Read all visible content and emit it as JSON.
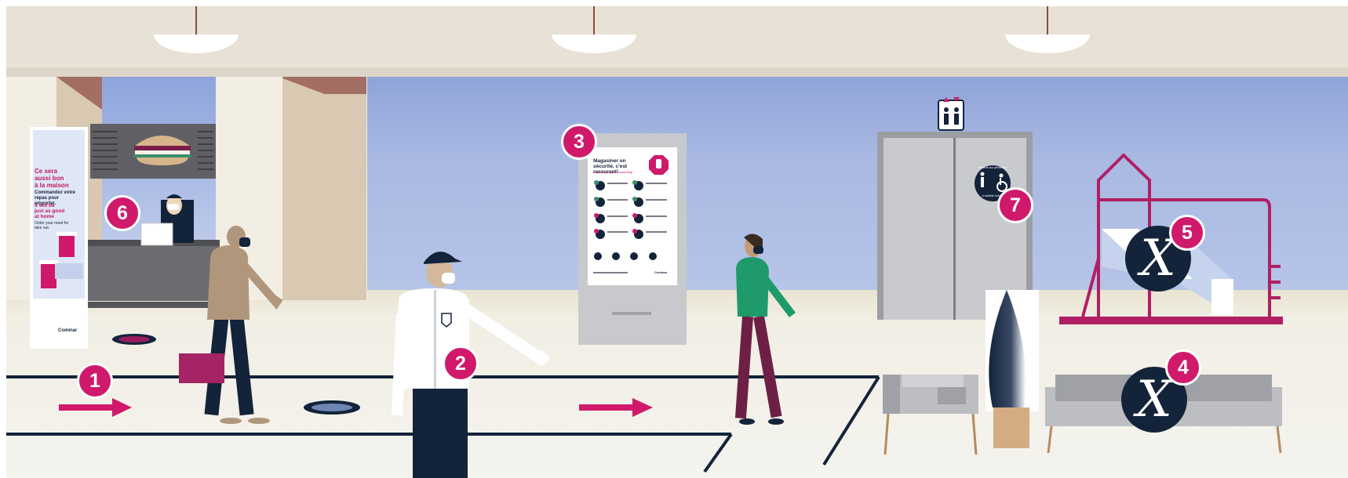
{
  "badges": [
    "1",
    "2",
    "3",
    "4",
    "5",
    "6",
    "7"
  ],
  "poster": {
    "fr_lines": [
      "Ce sera",
      "aussi bon",
      "à la maison"
    ],
    "fr_sub": "Commandez votre repas pour emporter.",
    "en_lines": [
      "It will be",
      "just as good",
      "at home"
    ],
    "en_sub": "Order your meal for take out.",
    "brand": "Cominar"
  },
  "kiosk": {
    "title": "Magasiner en sécurité, c'est rassurant!",
    "subtitle": "Safe shopping is reassuring!",
    "brand": "Cominar"
  },
  "elevator_sticker": {
    "top": "Réservé aux personnes",
    "bottom": "à mobilité réduite"
  },
  "closed_mark": "X",
  "colors": {
    "accent": "#d0196b",
    "navy": "#13233a",
    "ceiling": "#e7e1d6",
    "wall": "#a9b9e0",
    "floor": "#f1efe6"
  },
  "icons": [
    "restroom-icon",
    "wheelchair-icon",
    "stop-hand-icon",
    "arrow-right-icon",
    "burger-icon"
  ]
}
